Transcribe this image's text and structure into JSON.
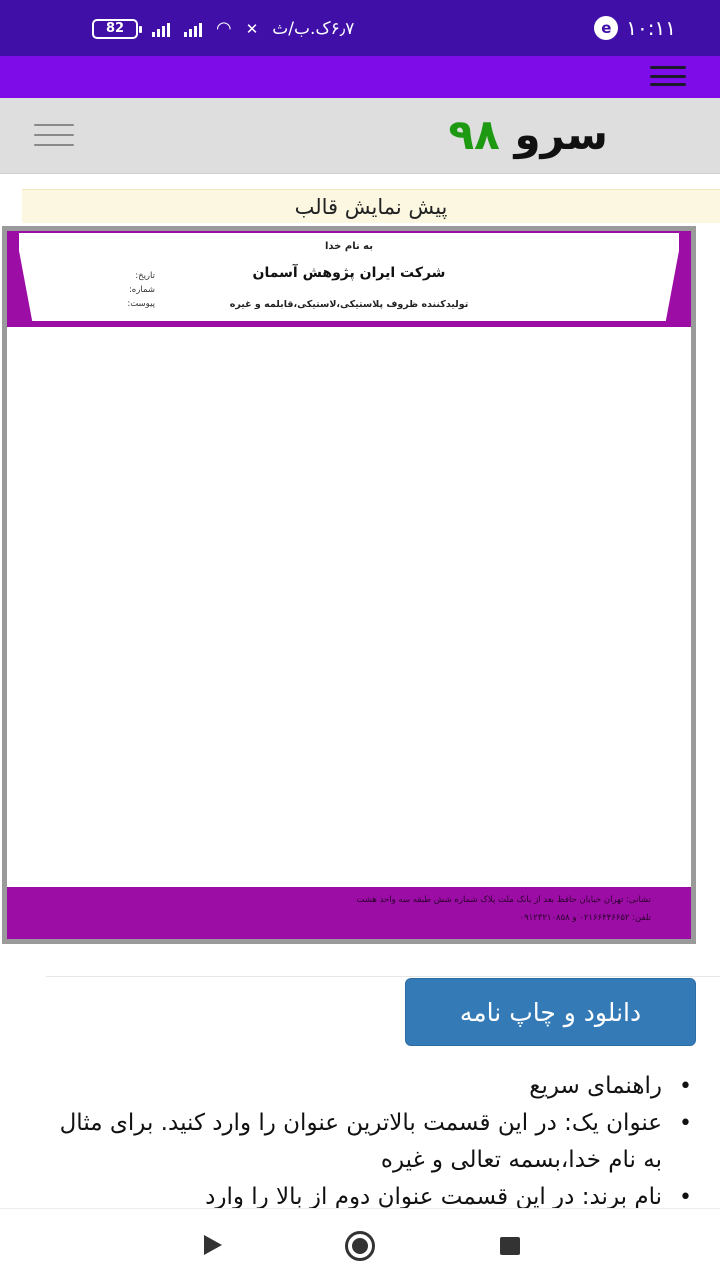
{
  "status_bar": {
    "time": "۱۰:۱۱",
    "app_icon": "e",
    "speed": "۶٫۷ک.ب/ث",
    "battery": "82"
  },
  "site": {
    "logo_word": "سرو",
    "logo_number": "۹۸"
  },
  "preview_label": "پیش نمایش قالب",
  "letterhead": {
    "basmala": "به نام خدا",
    "company": "شرکت ایران پژوهش آسمان",
    "description": "تولیدکننده ظروف پلاستیکی،لاستیکی،قابلمه و غیره",
    "fields": [
      "تاریخ:",
      "شماره:",
      "پیوست:"
    ],
    "address": "نشانی: تهران خیابان حافظ بعد از بانک ملت پلاک شماره شش طبقه سه واحد هشت",
    "phone": "تلفن: ۰۲۱۶۶۴۴۶۶۵۲ و ۰۹۱۲۳۲۱۰۸۵۸"
  },
  "download_button": "دانلود و چاپ نامه",
  "guide": {
    "items": [
      "راهنمای سریع",
      "عنوان یک: در این قسمت بالاترین عنوان را وارد کنید. برای مثال به نام خدا،بسمه تعالی و غیره",
      "نام برند: در این قسمت عنوان دوم از بالا را وارد"
    ]
  },
  "colors": {
    "status_bar": "#3f0fa8",
    "app_bar": "#7e0ce8",
    "letterhead_accent": "#9c0da6",
    "button": "#337ab7",
    "logo_number": "#1d9a12"
  }
}
